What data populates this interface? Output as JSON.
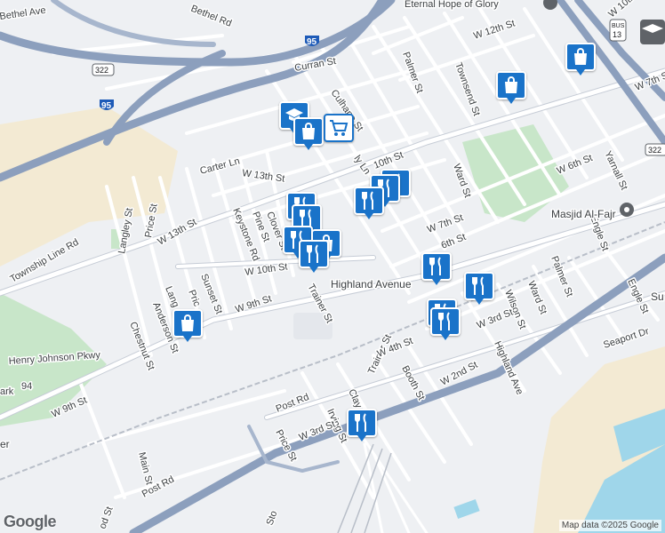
{
  "map": {
    "attribution": "Map data ©2025 Google",
    "logo_text": "Google",
    "colors": {
      "pin": "#1a73c9",
      "park": "#c8e6c9",
      "water": "#9fd6ea",
      "highway": "#8c9fbd",
      "sand": "#f3ead3"
    },
    "place_labels": {
      "masjid": "Masjid Al-Fajr",
      "eternal_hope": "Eternal Hope of Glory",
      "highland_avenue": "Highland Avenue",
      "henry_johnson": "Henry Johnson Pkwy",
      "park_number": "94",
      "park_fragment": "ark",
      "left_fragment": "er",
      "stop_fragment": "Sto",
      "su_fragment": "Su"
    },
    "street_labels": {
      "bethel_ave": "Bethel Ave",
      "bethel_rd": "Bethel Rd",
      "curran": "Curran St",
      "w12th": "W 12th St",
      "palmer_top": "Palmer St",
      "townsend": "Townsend St",
      "culhane": "Culhane St",
      "carter": "Carter Ln",
      "w13th_a": "W 13th St",
      "w13th_b": "W 13th St",
      "township": "Township Line Rd",
      "langley": "Langley St",
      "price_top": "Price St",
      "keystone": "Keystone Rd",
      "pine": "Pine St",
      "clover": "Clover St",
      "w10th": "W 10th St",
      "w7th": "W 7th St",
      "w6th": "W 6th St",
      "ward_top": "Ward St",
      "yarnall": "Yarnall St",
      "engle": "Engle St",
      "engle2": "Engle St",
      "palmer_mid": "Palmer St",
      "ward_mid": "Ward St",
      "wilson": "Wilson St",
      "w3rd_e": "W 3rd St",
      "w9th": "W 9th St",
      "w9th_w": "W 9th St",
      "trainer": "Trainer St",
      "trainer2": "Trainer St",
      "sunset": "Sunset St",
      "anderson": "Anderson St",
      "chestnut": "Chestnut St",
      "lang": "Lang",
      "pric": "Pric",
      "w4th": "W 4th St",
      "booth": "Booth St",
      "post": "Post Rd",
      "post2": "Post Rd",
      "price_s": "Price St",
      "w2nd": "W 2nd St",
      "highland_ave": "Highland Ave",
      "seaport": "Seaport Dr",
      "main": "Main St",
      "irving": "Irving St",
      "w3rd_w": "W 3rd St",
      "clay": "Clay",
      "ly_ln": "ly Ln",
      "w10_frag": "10th St",
      "h_6th": "6th St",
      "w10th_top": "W 10th",
      "w7th_top": "W 7th St",
      "od": "od St"
    },
    "shields": {
      "i95_a": "95",
      "i95_b": "95",
      "us322_a": "322",
      "us322_b": "322",
      "us13": "13",
      "bus": "BUS"
    },
    "markers": [
      {
        "type": "school",
        "icon": "school-icon"
      },
      {
        "type": "shopping",
        "icon": "shopping-bag-icon"
      },
      {
        "type": "grocery",
        "icon": "shopping-cart-icon"
      },
      {
        "type": "shopping",
        "icon": "shopping-bag-icon"
      },
      {
        "type": "shopping",
        "icon": "shopping-bag-icon"
      },
      {
        "type": "school",
        "icon": "school-icon"
      },
      {
        "type": "restaurant",
        "icon": "restaurant-icon"
      },
      {
        "type": "restaurant",
        "icon": "restaurant-icon"
      },
      {
        "type": "restaurant",
        "icon": "restaurant-icon"
      },
      {
        "type": "restaurant",
        "icon": "restaurant-icon"
      },
      {
        "type": "restaurant",
        "icon": "restaurant-icon"
      },
      {
        "type": "restaurant",
        "icon": "restaurant-icon"
      },
      {
        "type": "restaurant",
        "icon": "restaurant-icon"
      },
      {
        "type": "restaurant",
        "icon": "restaurant-icon"
      },
      {
        "type": "restaurant",
        "icon": "restaurant-icon"
      },
      {
        "type": "restaurant",
        "icon": "restaurant-icon"
      },
      {
        "type": "restaurant",
        "icon": "restaurant-icon"
      },
      {
        "type": "shopping",
        "icon": "shopping-bag-icon"
      }
    ]
  }
}
